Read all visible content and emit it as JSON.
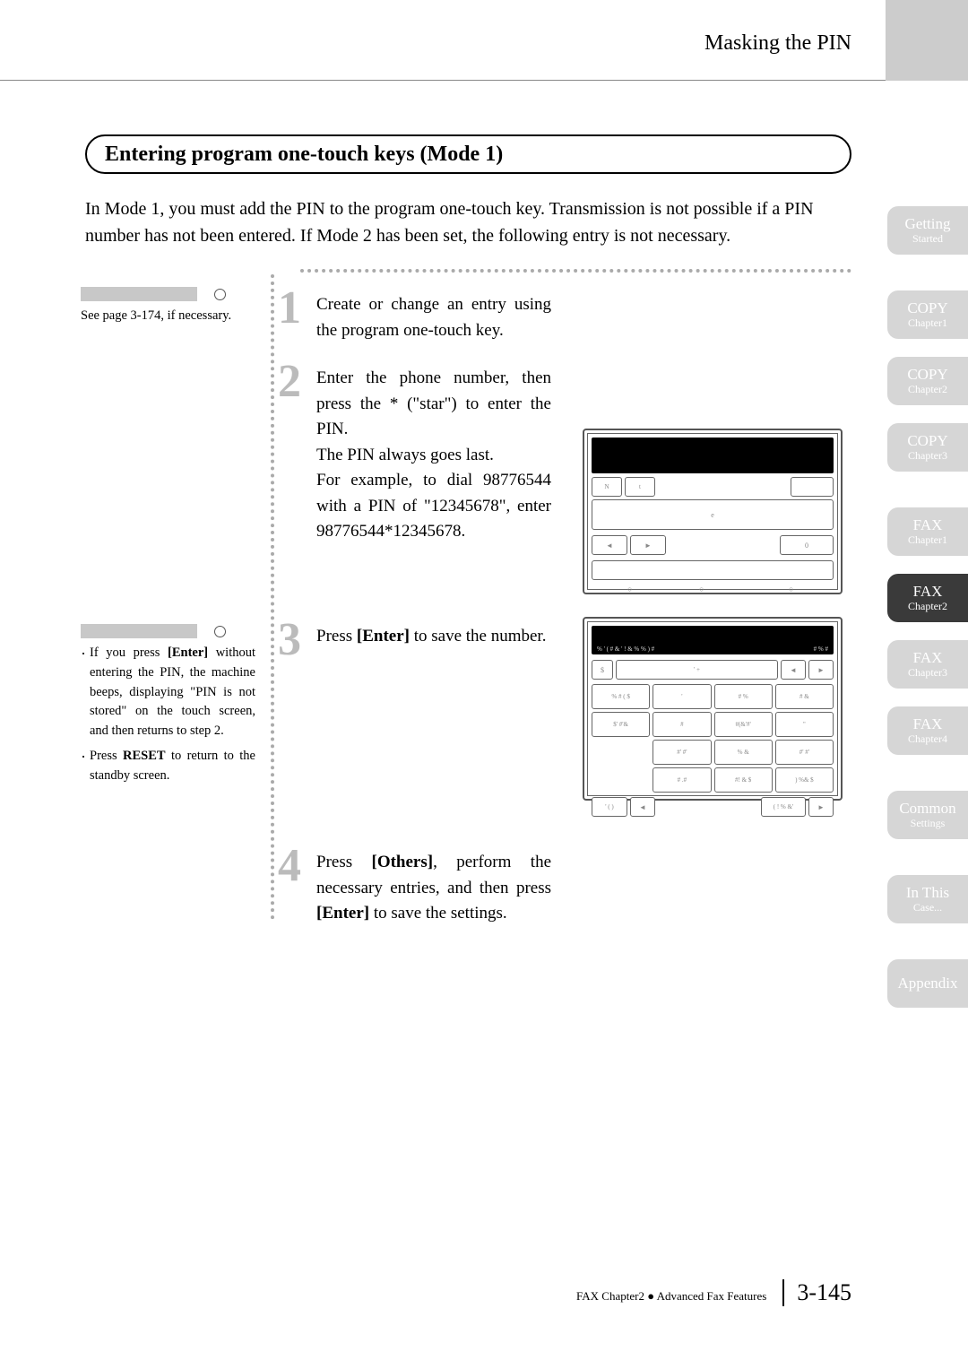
{
  "header": {
    "breadcrumb": "Masking the PIN"
  },
  "section": {
    "title": "Entering program one-touch keys (Mode 1)",
    "intro": "In Mode 1, you must add the PIN to the program one-touch key. Transmission is not possible if a PIN number has not been entered. If Mode 2 has been set, the following entry is not necessary."
  },
  "notes": {
    "note1": "See page 3-174, if necessary.",
    "note2_items": [
      "If you press [Enter] without entering the PIN, the machine beeps, displaying \"PIN is not stored\" on the touch screen, and then returns to step 2.",
      "Press RESET to return to the standby screen."
    ]
  },
  "steps": {
    "s1": {
      "num": "1",
      "text": "Create or change an entry using the program one-touch key."
    },
    "s2": {
      "num": "2",
      "text": "Enter the phone number, then press the * (\"star\") to enter the PIN.",
      "line2": "The PIN always goes last.",
      "line3": "For example, to dial 98776544 with a PIN of \"12345678\", enter 98776544*12345678."
    },
    "s3": {
      "num": "3",
      "text": "Press [Enter] to save the number."
    },
    "s4": {
      "num": "4",
      "text": "Press [Others], perform the necessary entries, and then press [Enter] to save the settings."
    }
  },
  "tabs": [
    {
      "title": "Getting",
      "sub": "Started",
      "active": false
    },
    {
      "title": "COPY",
      "sub": "Chapter1",
      "active": false
    },
    {
      "title": "COPY",
      "sub": "Chapter2",
      "active": false
    },
    {
      "title": "COPY",
      "sub": "Chapter3",
      "active": false
    },
    {
      "title": "FAX",
      "sub": "Chapter1",
      "active": false
    },
    {
      "title": "FAX",
      "sub": "Chapter2",
      "active": true
    },
    {
      "title": "FAX",
      "sub": "Chapter3",
      "active": false
    },
    {
      "title": "FAX",
      "sub": "Chapter4",
      "active": false
    },
    {
      "title": "Common",
      "sub": "Settings",
      "active": false
    },
    {
      "title": "In This",
      "sub": "Case...",
      "active": false
    },
    {
      "title": "Appendix",
      "sub": "",
      "active": false
    }
  ],
  "footer": {
    "chapter": "FAX Chapter2 ● Advanced Fax Features",
    "page": "3-145"
  },
  "lcd1_btn_e": "e",
  "lcd1_btn_0": "0"
}
